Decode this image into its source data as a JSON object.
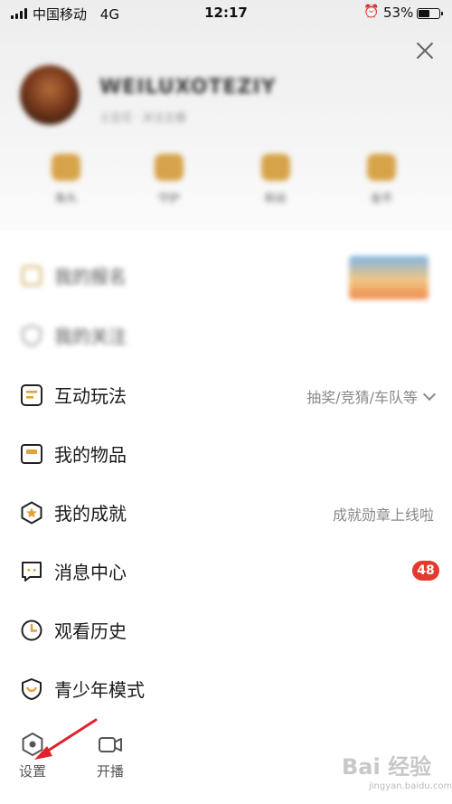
{
  "status_bar": {
    "carrier": "中国移动",
    "network": "4G",
    "time": "12:17",
    "battery": "53%",
    "battery_level": 0.53
  },
  "header": {
    "username": "WEILUXOTEZIY",
    "subline": "土豆花 · 关注主播",
    "assets": [
      "鱼丸",
      "守护",
      "粉丝",
      "金币"
    ]
  },
  "menu": {
    "blurred": [
      {
        "label": "我的报名"
      },
      {
        "label": "我的关注"
      }
    ],
    "items": [
      {
        "label": "互动玩法",
        "hint": "抽奖/竞猜/车队等"
      },
      {
        "label": "我的物品"
      },
      {
        "label": "我的成就",
        "hint": "成就勋章上线啦"
      },
      {
        "label": "消息中心",
        "badge": "48"
      },
      {
        "label": "观看历史"
      },
      {
        "label": "青少年模式"
      }
    ]
  },
  "bottom": {
    "settings": "设置",
    "broadcast": "开播"
  },
  "watermark": {
    "main": "Bai 经验",
    "sub": "jingyan.baidu.com"
  },
  "colors": {
    "accent": "#e0a23a",
    "badge": "#e5392e",
    "arrow": "#e0232a"
  }
}
